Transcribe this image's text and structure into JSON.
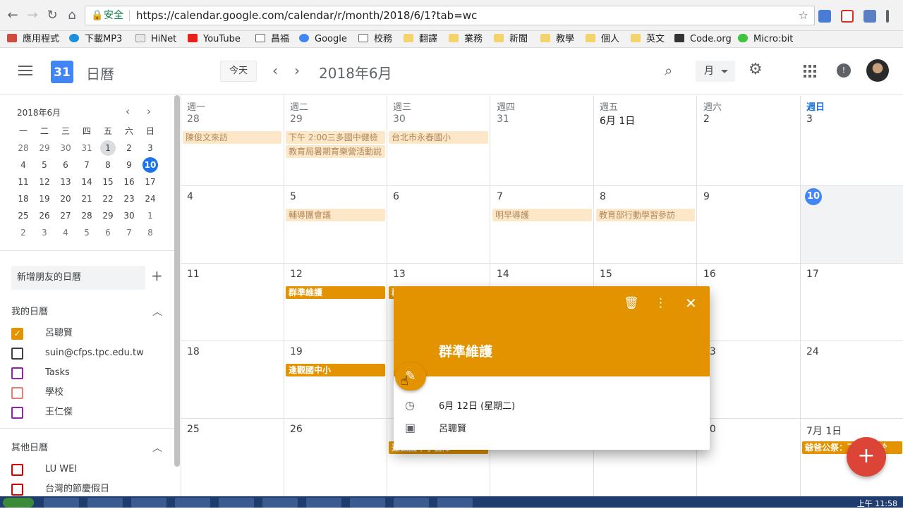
{
  "browser": {
    "secure_label": "安全",
    "url": "https://calendar.google.com/calendar/r/month/2018/6/1?tab=wc",
    "bookmarks": [
      "應用程式",
      "下載MP3",
      "HiNet",
      "YouTube",
      "昌福",
      "Google",
      "校務",
      "翻譯",
      "業務",
      "新聞",
      "教學",
      "個人",
      "英文",
      "Code.org",
      "Micro:bit"
    ]
  },
  "header": {
    "app_name": "日曆",
    "logo_number": "31",
    "today_label": "今天",
    "month_title": "2018年6月",
    "view_label": "月"
  },
  "mini_calendar": {
    "title": "2018年6月",
    "weekdays": [
      "一",
      "二",
      "三",
      "四",
      "五",
      "六",
      "日"
    ],
    "weeks": [
      [
        "28",
        "29",
        "30",
        "31",
        "1",
        "2",
        "3"
      ],
      [
        "4",
        "5",
        "6",
        "7",
        "8",
        "9",
        "10"
      ],
      [
        "11",
        "12",
        "13",
        "14",
        "15",
        "16",
        "17"
      ],
      [
        "18",
        "19",
        "20",
        "21",
        "22",
        "23",
        "24"
      ],
      [
        "25",
        "26",
        "27",
        "28",
        "29",
        "30",
        "1"
      ],
      [
        "2",
        "3",
        "4",
        "5",
        "6",
        "7",
        "8"
      ]
    ]
  },
  "sidebar": {
    "add_friend_placeholder": "新增朋友的日曆",
    "my_calendars_title": "我的日曆",
    "my_calendars": [
      {
        "label": "呂聰賢",
        "color": "#e39300",
        "checked": true
      },
      {
        "label": "suin@cfps.tpc.edu.tw",
        "color": "#3c4043",
        "checked": false
      },
      {
        "label": "Tasks",
        "color": "#8e24aa",
        "checked": false
      },
      {
        "label": "學校",
        "color": "#e67c73",
        "checked": false
      },
      {
        "label": "王仁傑",
        "color": "#8e24aa",
        "checked": false
      }
    ],
    "other_calendars_title": "其他日曆",
    "other_calendars": [
      {
        "label": "LU WEI",
        "color": "#d50000",
        "checked": false
      },
      {
        "label": "台灣的節慶假日",
        "color": "#d50000",
        "checked": false
      }
    ]
  },
  "month": {
    "headers": [
      {
        "dow": "週一",
        "num": "28"
      },
      {
        "dow": "週二",
        "num": "29"
      },
      {
        "dow": "週三",
        "num": "30"
      },
      {
        "dow": "週四",
        "num": "31"
      },
      {
        "dow": "週五",
        "num": "6月 1日"
      },
      {
        "dow": "週六",
        "num": "2"
      },
      {
        "dow": "週日",
        "num": "3"
      }
    ],
    "week_nums": [
      [
        "4",
        "5",
        "6",
        "7",
        "8",
        "9",
        "10"
      ],
      [
        "11",
        "12",
        "13",
        "14",
        "15",
        "16",
        "17"
      ],
      [
        "18",
        "19",
        "20",
        "21",
        "22",
        "23",
        "24"
      ],
      [
        "25",
        "26",
        "27",
        "28",
        "29",
        "30",
        "7月 1日"
      ]
    ],
    "events": {
      "e1": "陳俊文來訪",
      "e2": "下午 2:00三多國中健檢",
      "e3": "教育局暑期育樂營活動說",
      "e4": "台北市永春國小",
      "e5": "輔導團會議",
      "e6": "明早導護",
      "e7": "教育部行動學習參訪",
      "e8": "群準維護",
      "e9": "群",
      "e10": "逢觀國中小",
      "e11": "逢觀國中小營隊",
      "e12": "爺爸公祭：下午1半於"
    }
  },
  "popup": {
    "title": "群準維護",
    "date": "6月 12日 (星期二)",
    "calendar": "呂聰賢",
    "color": "#e39300"
  },
  "taskbar": {
    "clock": "上午 11:58"
  }
}
